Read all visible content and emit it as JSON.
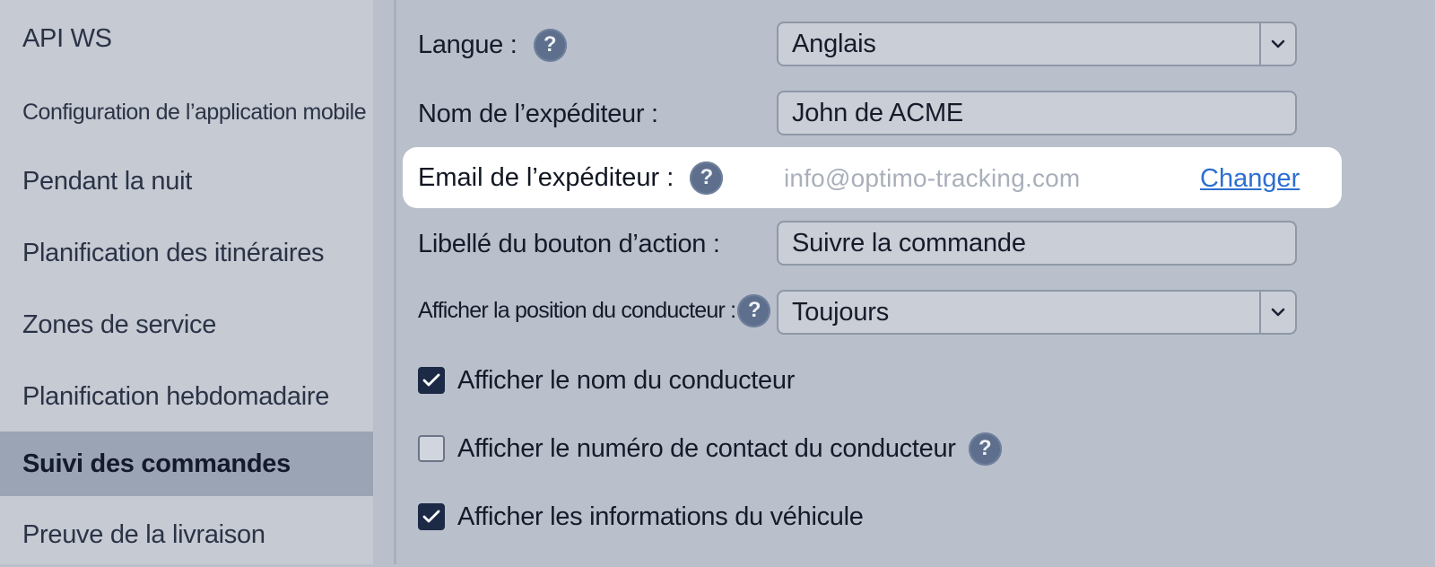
{
  "sidebar": {
    "items": [
      {
        "label": "API WS",
        "active": false
      },
      {
        "label": "Configuration de l’application mobile",
        "active": false
      },
      {
        "label": "Pendant la nuit",
        "active": false
      },
      {
        "label": "Planification des itinéraires",
        "active": false
      },
      {
        "label": "Zones de service",
        "active": false
      },
      {
        "label": "Planification hebdomadaire",
        "active": false
      },
      {
        "label": "Suivi des commandes",
        "active": true
      },
      {
        "label": "Preuve de la livraison",
        "active": false
      }
    ]
  },
  "form": {
    "language": {
      "label": "Langue :",
      "help": "?",
      "value": "Anglais"
    },
    "sender_name": {
      "label": "Nom de l’expéditeur :",
      "value": "John de ACME"
    },
    "sender_email": {
      "label": "Email de l’expéditeur :",
      "help": "?",
      "value": "info@optimo-tracking.com",
      "change_link": "Changer"
    },
    "action_button": {
      "label": "Libellé du bouton d’action :",
      "value": "Suivre la commande"
    },
    "driver_position": {
      "label": "Afficher la position du conducteur :",
      "help": "?",
      "value": "Toujours"
    },
    "checkboxes": [
      {
        "label": "Afficher le nom du conducteur",
        "checked": true
      },
      {
        "label": "Afficher le numéro de contact du conducteur",
        "checked": false,
        "help": "?"
      },
      {
        "label": "Afficher les informations du véhicule",
        "checked": true
      }
    ]
  },
  "colors": {
    "accent_link": "#2d6fd0",
    "checkbox_checked": "#1c2a46",
    "help_icon": "#5d6f8c",
    "sidebar_active": "#9aa4b5"
  }
}
